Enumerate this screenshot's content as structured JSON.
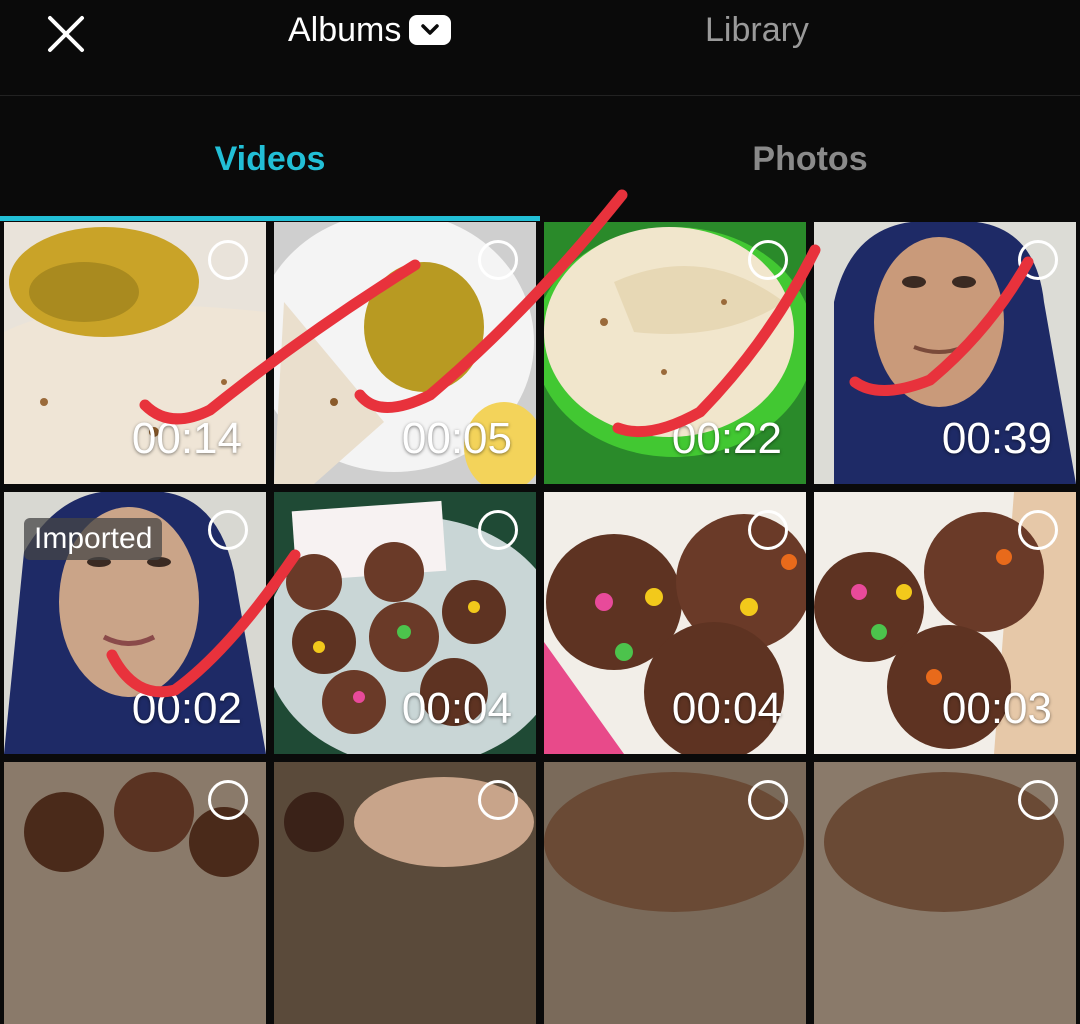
{
  "header": {
    "close_icon": "close-icon",
    "albums_label": "Albums",
    "albums_icon": "chevron-down-icon",
    "library_label": "Library"
  },
  "tabs": {
    "videos_label": "Videos",
    "photos_label": "Photos",
    "active": "Videos"
  },
  "colors": {
    "accent": "#22bfd6",
    "background": "#0a0a0a",
    "annotation": "#e8323c"
  },
  "videos": [
    {
      "duration": "00:14",
      "imported": ""
    },
    {
      "duration": "00:05",
      "imported": ""
    },
    {
      "duration": "00:22",
      "imported": ""
    },
    {
      "duration": "00:39",
      "imported": ""
    },
    {
      "duration": "00:02",
      "imported": "Imported"
    },
    {
      "duration": "00:04",
      "imported": ""
    },
    {
      "duration": "00:04",
      "imported": ""
    },
    {
      "duration": "00:03",
      "imported": ""
    },
    {
      "duration": "",
      "imported": ""
    },
    {
      "duration": "",
      "imported": ""
    },
    {
      "duration": "",
      "imported": ""
    },
    {
      "duration": "",
      "imported": ""
    }
  ]
}
